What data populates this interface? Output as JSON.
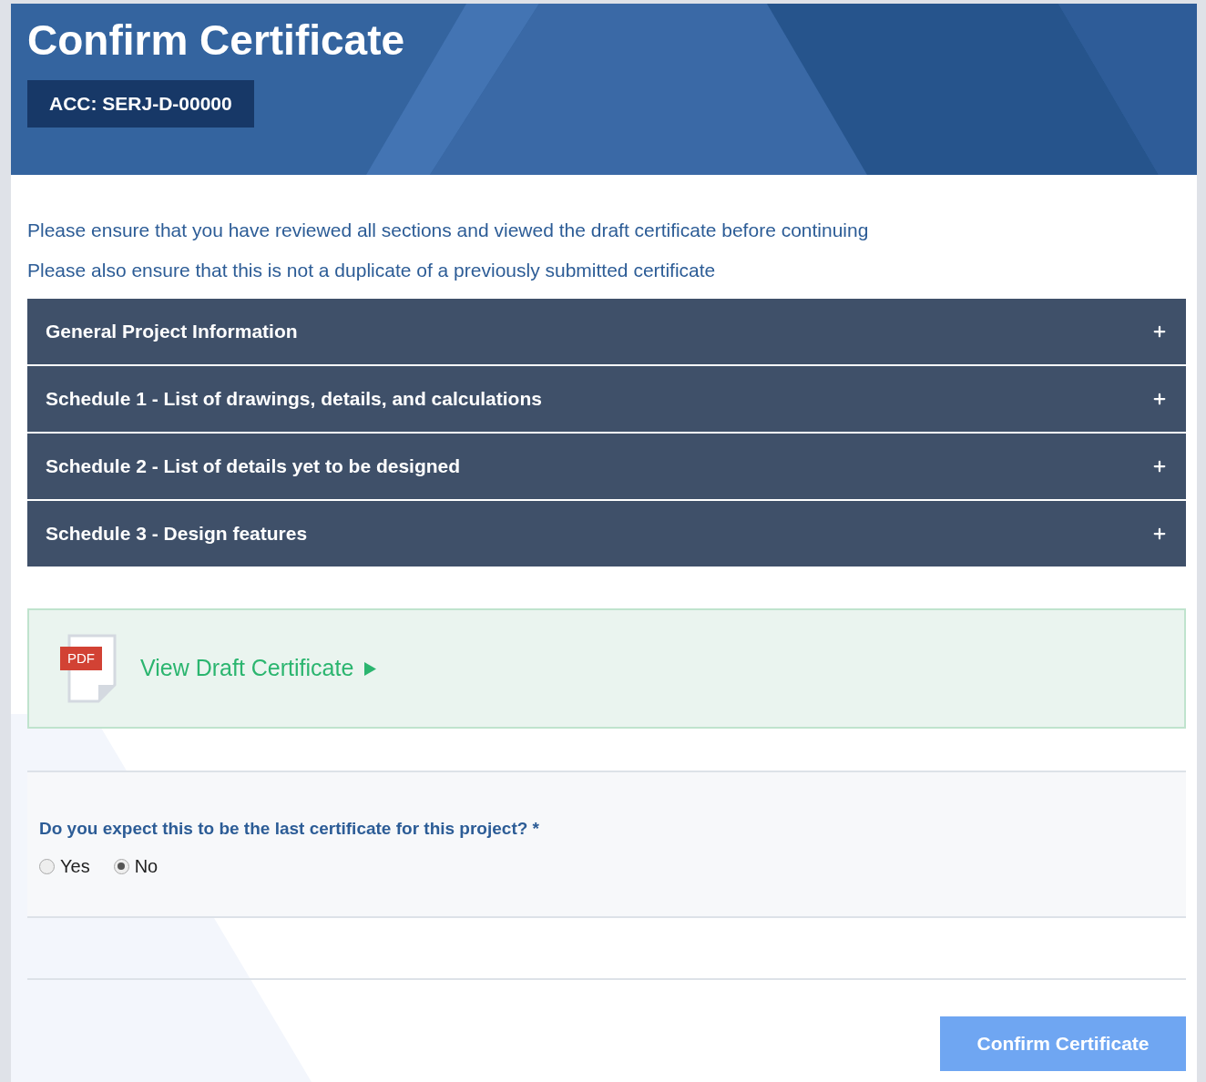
{
  "title": "Confirm Certificate",
  "account_badge": "ACC: SERJ-D-00000",
  "notices": [
    "Please ensure that you have reviewed all sections and viewed the draft certificate before continuing",
    "Please also ensure that this is not a duplicate of a previously submitted certificate"
  ],
  "sections": [
    {
      "title": "General Project Information",
      "expanded": false
    },
    {
      "title": "Schedule 1 - List of drawings, details, and calculations",
      "expanded": false
    },
    {
      "title": "Schedule 2 - List of details yet to be designed",
      "expanded": false
    },
    {
      "title": "Schedule 3 - Design features",
      "expanded": false
    }
  ],
  "draft_link": {
    "file_type": "PDF",
    "label": "View Draft Certificate"
  },
  "question": {
    "label": "Do you expect this to be the last certificate for this project? *",
    "options": [
      {
        "label": "Yes",
        "selected": false
      },
      {
        "label": "No",
        "selected": true
      }
    ]
  },
  "confirm_button": "Confirm Certificate"
}
